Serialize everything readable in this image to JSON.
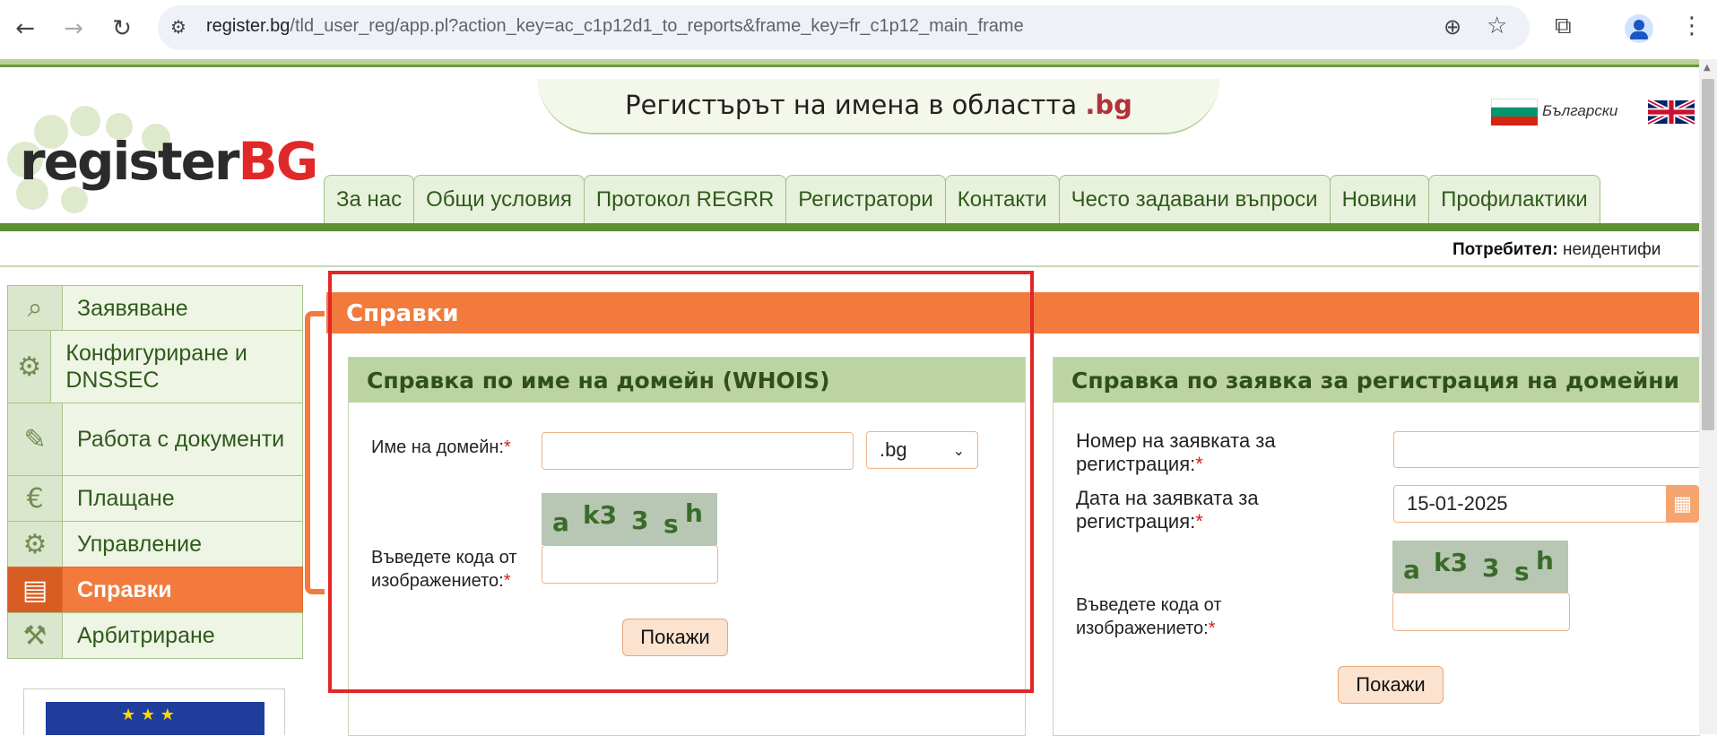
{
  "browser": {
    "url_host": "register.bg",
    "url_path": "/tld_user_reg/app.pl?action_key=ac_c1p12d1_to_reports&frame_key=fr_c1p12_main_frame"
  },
  "site": {
    "title": "Регистърът на имена в областта",
    "title_tld": ".bg",
    "logo_text": "register",
    "logo_bg": "BG",
    "lang_bg": "Български",
    "user_label": "Потребител:",
    "user_value": "неидентифи"
  },
  "nav": [
    "За нас",
    "Общи условия",
    "Протокол REGRR",
    "Регистратори",
    "Контакти",
    "Често задавани въпроси",
    "Новини",
    "Профилактики"
  ],
  "sidebar": {
    "items": [
      {
        "label": "Заявяване",
        "icon": "magnifier-icon"
      },
      {
        "label": "Конфигуриране и DNSSEC",
        "icon": "gear-icon"
      },
      {
        "label": "Работа с документи",
        "icon": "documents-icon"
      },
      {
        "label": "Плащане",
        "icon": "euro-bag-icon"
      },
      {
        "label": "Управление",
        "icon": "gears-icon"
      },
      {
        "label": "Справки",
        "icon": "report-icon"
      },
      {
        "label": "Арбитриране",
        "icon": "gavel-icon"
      }
    ]
  },
  "main": {
    "title": "Справки",
    "whois": {
      "heading": "Справка по име на домейн (WHOIS)",
      "domain_label": "Име на домейн:",
      "domain_value": "",
      "tld_selected": ".bg",
      "captcha_label": "Въведете кода от изображението:",
      "captcha_chars": [
        "a",
        "k3",
        "3",
        "s",
        "h"
      ],
      "button": "Покажи"
    },
    "registration": {
      "heading": "Справка по заявка за регистрация на домейни",
      "number_label": "Номер на заявката за регистрация:",
      "number_value": "",
      "date_label": "Дата на заявката за регистрация:",
      "date_value": "15-01-2025",
      "captcha_label": "Въведете кода от изображението:",
      "button": "Покажи"
    },
    "required_mark": "*"
  },
  "colors": {
    "accent": "#f27a3c",
    "green": "#5d8f33",
    "highlight": "#e32626"
  }
}
